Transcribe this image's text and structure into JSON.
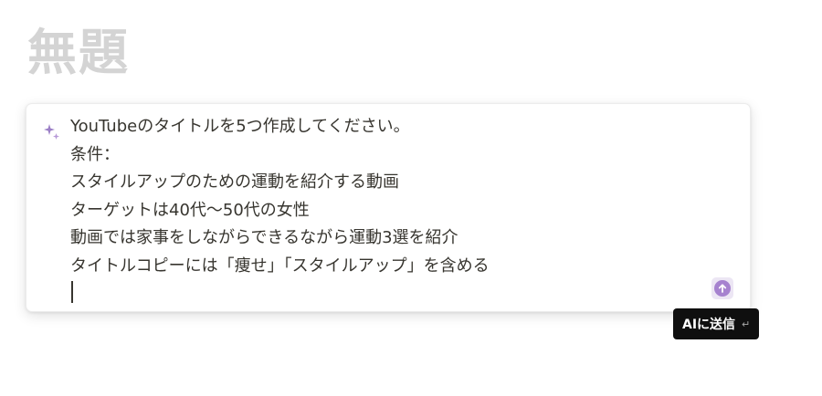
{
  "page": {
    "title": "無題"
  },
  "ai_prompt": {
    "lines": [
      "YouTubeのタイトルを5つ作成してください。",
      "条件：",
      "スタイルアップのための運動を紹介する動画",
      "ターゲットは40代〜50代の女性",
      "動画では家事をしながらできるながら運動3選を紹介",
      "タイトルコピーには「痩せ」「スタイルアップ」を含める"
    ],
    "icon": "sparkle-icon",
    "send_icon": "arrow-up-icon"
  },
  "tooltip": {
    "label": "AIに送信",
    "shortcut": "↵"
  },
  "colors": {
    "accent": "#a682cf",
    "text": "#37352f",
    "title_placeholder": "#d4d4d4",
    "tooltip_bg": "#0f0f0f"
  }
}
